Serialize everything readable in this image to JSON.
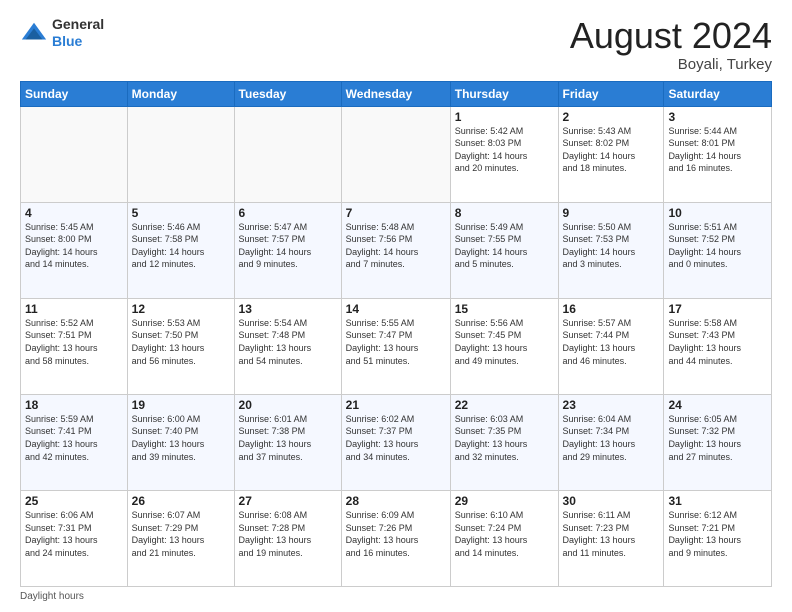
{
  "header": {
    "logo_line1": "General",
    "logo_line2": "Blue",
    "main_title": "August 2024",
    "subtitle": "Boyali, Turkey"
  },
  "days_of_week": [
    "Sunday",
    "Monday",
    "Tuesday",
    "Wednesday",
    "Thursday",
    "Friday",
    "Saturday"
  ],
  "weeks": [
    [
      {
        "day": "",
        "info": ""
      },
      {
        "day": "",
        "info": ""
      },
      {
        "day": "",
        "info": ""
      },
      {
        "day": "",
        "info": ""
      },
      {
        "day": "1",
        "info": "Sunrise: 5:42 AM\nSunset: 8:03 PM\nDaylight: 14 hours\nand 20 minutes."
      },
      {
        "day": "2",
        "info": "Sunrise: 5:43 AM\nSunset: 8:02 PM\nDaylight: 14 hours\nand 18 minutes."
      },
      {
        "day": "3",
        "info": "Sunrise: 5:44 AM\nSunset: 8:01 PM\nDaylight: 14 hours\nand 16 minutes."
      }
    ],
    [
      {
        "day": "4",
        "info": "Sunrise: 5:45 AM\nSunset: 8:00 PM\nDaylight: 14 hours\nand 14 minutes."
      },
      {
        "day": "5",
        "info": "Sunrise: 5:46 AM\nSunset: 7:58 PM\nDaylight: 14 hours\nand 12 minutes."
      },
      {
        "day": "6",
        "info": "Sunrise: 5:47 AM\nSunset: 7:57 PM\nDaylight: 14 hours\nand 9 minutes."
      },
      {
        "day": "7",
        "info": "Sunrise: 5:48 AM\nSunset: 7:56 PM\nDaylight: 14 hours\nand 7 minutes."
      },
      {
        "day": "8",
        "info": "Sunrise: 5:49 AM\nSunset: 7:55 PM\nDaylight: 14 hours\nand 5 minutes."
      },
      {
        "day": "9",
        "info": "Sunrise: 5:50 AM\nSunset: 7:53 PM\nDaylight: 14 hours\nand 3 minutes."
      },
      {
        "day": "10",
        "info": "Sunrise: 5:51 AM\nSunset: 7:52 PM\nDaylight: 14 hours\nand 0 minutes."
      }
    ],
    [
      {
        "day": "11",
        "info": "Sunrise: 5:52 AM\nSunset: 7:51 PM\nDaylight: 13 hours\nand 58 minutes."
      },
      {
        "day": "12",
        "info": "Sunrise: 5:53 AM\nSunset: 7:50 PM\nDaylight: 13 hours\nand 56 minutes."
      },
      {
        "day": "13",
        "info": "Sunrise: 5:54 AM\nSunset: 7:48 PM\nDaylight: 13 hours\nand 54 minutes."
      },
      {
        "day": "14",
        "info": "Sunrise: 5:55 AM\nSunset: 7:47 PM\nDaylight: 13 hours\nand 51 minutes."
      },
      {
        "day": "15",
        "info": "Sunrise: 5:56 AM\nSunset: 7:45 PM\nDaylight: 13 hours\nand 49 minutes."
      },
      {
        "day": "16",
        "info": "Sunrise: 5:57 AM\nSunset: 7:44 PM\nDaylight: 13 hours\nand 46 minutes."
      },
      {
        "day": "17",
        "info": "Sunrise: 5:58 AM\nSunset: 7:43 PM\nDaylight: 13 hours\nand 44 minutes."
      }
    ],
    [
      {
        "day": "18",
        "info": "Sunrise: 5:59 AM\nSunset: 7:41 PM\nDaylight: 13 hours\nand 42 minutes."
      },
      {
        "day": "19",
        "info": "Sunrise: 6:00 AM\nSunset: 7:40 PM\nDaylight: 13 hours\nand 39 minutes."
      },
      {
        "day": "20",
        "info": "Sunrise: 6:01 AM\nSunset: 7:38 PM\nDaylight: 13 hours\nand 37 minutes."
      },
      {
        "day": "21",
        "info": "Sunrise: 6:02 AM\nSunset: 7:37 PM\nDaylight: 13 hours\nand 34 minutes."
      },
      {
        "day": "22",
        "info": "Sunrise: 6:03 AM\nSunset: 7:35 PM\nDaylight: 13 hours\nand 32 minutes."
      },
      {
        "day": "23",
        "info": "Sunrise: 6:04 AM\nSunset: 7:34 PM\nDaylight: 13 hours\nand 29 minutes."
      },
      {
        "day": "24",
        "info": "Sunrise: 6:05 AM\nSunset: 7:32 PM\nDaylight: 13 hours\nand 27 minutes."
      }
    ],
    [
      {
        "day": "25",
        "info": "Sunrise: 6:06 AM\nSunset: 7:31 PM\nDaylight: 13 hours\nand 24 minutes."
      },
      {
        "day": "26",
        "info": "Sunrise: 6:07 AM\nSunset: 7:29 PM\nDaylight: 13 hours\nand 21 minutes."
      },
      {
        "day": "27",
        "info": "Sunrise: 6:08 AM\nSunset: 7:28 PM\nDaylight: 13 hours\nand 19 minutes."
      },
      {
        "day": "28",
        "info": "Sunrise: 6:09 AM\nSunset: 7:26 PM\nDaylight: 13 hours\nand 16 minutes."
      },
      {
        "day": "29",
        "info": "Sunrise: 6:10 AM\nSunset: 7:24 PM\nDaylight: 13 hours\nand 14 minutes."
      },
      {
        "day": "30",
        "info": "Sunrise: 6:11 AM\nSunset: 7:23 PM\nDaylight: 13 hours\nand 11 minutes."
      },
      {
        "day": "31",
        "info": "Sunrise: 6:12 AM\nSunset: 7:21 PM\nDaylight: 13 hours\nand 9 minutes."
      }
    ]
  ],
  "footer": {
    "note": "Daylight hours"
  }
}
